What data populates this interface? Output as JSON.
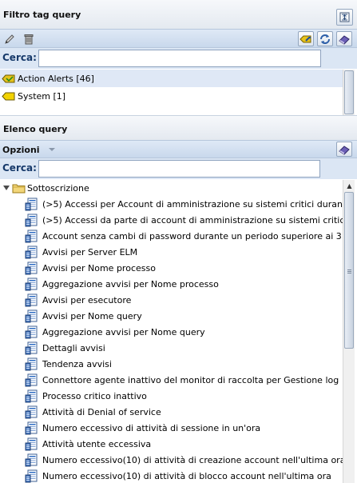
{
  "tag_filter": {
    "title": "Filtro tag query",
    "search_label": "Cerca:",
    "search_value": "",
    "tags": [
      {
        "label": "Action Alerts [46]",
        "selected": true,
        "color": "#e4c21d"
      },
      {
        "label": "System [1]",
        "selected": false,
        "color": "#f2d200"
      }
    ]
  },
  "query_list": {
    "title": "Elenco query",
    "options_label": "Opzioni",
    "search_label": "Cerca:",
    "search_value": "",
    "root_folder": "Sottoscrizione",
    "items": [
      "(>5) Accessi per Account di amministrazione su sistemi critici duran",
      "(>5) Accessi da parte di account di amministrazione su sistemi critic",
      "Account senza cambi di password durante un periodo superiore ai 3",
      "Avvisi per Server ELM",
      "Avvisi per Nome processo",
      "Aggregazione avvisi per Nome processo",
      "Avvisi per esecutore",
      "Avvisi per Nome query",
      "Aggregazione avvisi per Nome query",
      "Dettagli avvisi",
      "Tendenza avvisi",
      "Connettore agente inattivo del monitor di raccolta per Gestione log",
      "Processo critico inattivo",
      "Attività di Denial of service",
      "Numero eccessivo di attività di sessione in un'ora",
      "Attività utente eccessiva",
      "Numero eccessivo(10) di attività di creazione account nell'ultima ora",
      "Numero eccessivo(10) di attività di blocco account nell'ultima ora"
    ]
  },
  "icons": {
    "collapse": "collapse-panel-icon",
    "edit": "pencil-icon",
    "delete": "trash-icon",
    "tag_tools": [
      "tag-link-icon",
      "refresh-icon",
      "eraser-icon"
    ],
    "options_dropdown": "chevron-down-icon",
    "query_clear": "eraser-icon",
    "folder": "folder-icon",
    "query": "query-report-icon",
    "tag": "tag-icon"
  },
  "colors": {
    "toolbar": "#c8d8ec",
    "search_band": "#dbe6f4",
    "selected_row": "#dfe8f6",
    "label_blue": "#16396a"
  }
}
